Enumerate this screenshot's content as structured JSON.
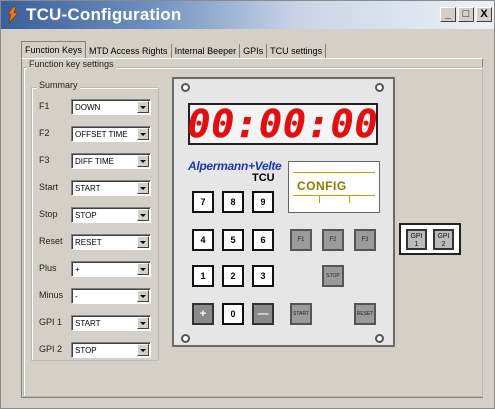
{
  "window": {
    "title": "TCU-Configuration",
    "controls": [
      "_",
      "□",
      "X"
    ]
  },
  "tabs": [
    {
      "label": "Function Keys",
      "active": true
    },
    {
      "label": "MTD Access Rights"
    },
    {
      "label": "Internal Beeper"
    },
    {
      "label": "GPIs"
    },
    {
      "label": "TCU settings"
    }
  ],
  "panel": {
    "group_label": "Function key settings",
    "summary_label": "Summary"
  },
  "function_keys": [
    {
      "label": "F1",
      "value": "DOWN"
    },
    {
      "label": "F2",
      "value": "OFFSET TIME"
    },
    {
      "label": "F3",
      "value": "DIFF TIME"
    },
    {
      "label": "Start",
      "value": "START"
    },
    {
      "label": "Stop",
      "value": "STOP"
    },
    {
      "label": "Reset",
      "value": "RESET"
    },
    {
      "label": "Plus",
      "value": "+"
    },
    {
      "label": "Minus",
      "value": "-"
    },
    {
      "label": "GPI 1",
      "value": "START"
    },
    {
      "label": "GPI 2",
      "value": "STOP"
    }
  ],
  "device": {
    "display": "00:00:00",
    "display_color": "#e01010",
    "brand": "Alpermann+Velte",
    "brand_sub": "TCU",
    "config_label": "CONFIG",
    "keys": {
      "k7": "7",
      "k8": "8",
      "k9": "9",
      "k4": "4",
      "k5": "5",
      "k6": "6",
      "k1": "1",
      "k2": "2",
      "k3": "3",
      "plus": "+",
      "zero": "0",
      "minus": "—",
      "f1": "F1",
      "f2": "F2",
      "f3": "F3",
      "stop": "STOP",
      "start": "START",
      "reset": "RESET"
    },
    "gpi": {
      "gpi1": "GPI 1",
      "gpi2": "GPI 2"
    }
  }
}
